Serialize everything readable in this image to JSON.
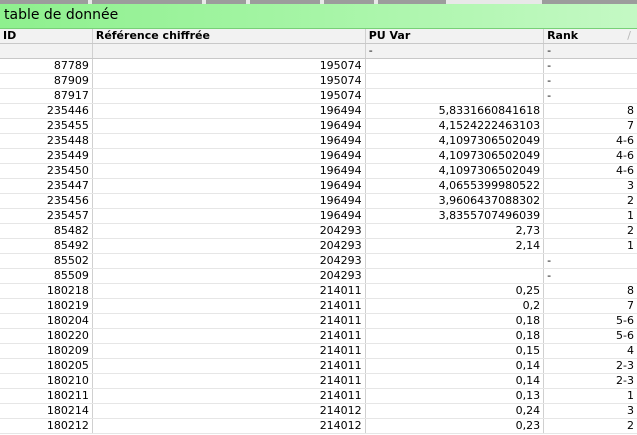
{
  "window": {
    "title": "table de donnée"
  },
  "columns": {
    "id": "ID",
    "reference": "Référence chiffrée",
    "pu_var": "PU Var",
    "rank": "Rank"
  },
  "totals": {
    "pu_var": "-",
    "rank": "-"
  },
  "rows": [
    {
      "id": "87789",
      "ref": "195074",
      "pu": "",
      "rank": "-"
    },
    {
      "id": "87909",
      "ref": "195074",
      "pu": "",
      "rank": "-"
    },
    {
      "id": "87917",
      "ref": "195074",
      "pu": "",
      "rank": "-"
    },
    {
      "id": "235446",
      "ref": "196494",
      "pu": "5,8331660841618",
      "rank": "8"
    },
    {
      "id": "235455",
      "ref": "196494",
      "pu": "4,1524222463103",
      "rank": "7"
    },
    {
      "id": "235448",
      "ref": "196494",
      "pu": "4,1097306502049",
      "rank": "4-6"
    },
    {
      "id": "235449",
      "ref": "196494",
      "pu": "4,1097306502049",
      "rank": "4-6"
    },
    {
      "id": "235450",
      "ref": "196494",
      "pu": "4,1097306502049",
      "rank": "4-6"
    },
    {
      "id": "235447",
      "ref": "196494",
      "pu": "4,0655399980522",
      "rank": "3"
    },
    {
      "id": "235456",
      "ref": "196494",
      "pu": "3,9606437088302",
      "rank": "2"
    },
    {
      "id": "235457",
      "ref": "196494",
      "pu": "3,8355707496039",
      "rank": "1"
    },
    {
      "id": "85482",
      "ref": "204293",
      "pu": "2,73",
      "rank": "2"
    },
    {
      "id": "85492",
      "ref": "204293",
      "pu": "2,14",
      "rank": "1"
    },
    {
      "id": "85502",
      "ref": "204293",
      "pu": "",
      "rank": "-"
    },
    {
      "id": "85509",
      "ref": "204293",
      "pu": "",
      "rank": "-"
    },
    {
      "id": "180218",
      "ref": "214011",
      "pu": "0,25",
      "rank": "8"
    },
    {
      "id": "180219",
      "ref": "214011",
      "pu": "0,2",
      "rank": "7"
    },
    {
      "id": "180204",
      "ref": "214011",
      "pu": "0,18",
      "rank": "5-6"
    },
    {
      "id": "180220",
      "ref": "214011",
      "pu": "0,18",
      "rank": "5-6"
    },
    {
      "id": "180209",
      "ref": "214011",
      "pu": "0,15",
      "rank": "4"
    },
    {
      "id": "180205",
      "ref": "214011",
      "pu": "0,14",
      "rank": "2-3"
    },
    {
      "id": "180210",
      "ref": "214011",
      "pu": "0,14",
      "rank": "2-3"
    },
    {
      "id": "180211",
      "ref": "214011",
      "pu": "0,13",
      "rank": "1"
    },
    {
      "id": "180214",
      "ref": "214012",
      "pu": "0,24",
      "rank": "3"
    },
    {
      "id": "180212",
      "ref": "214012",
      "pu": "0,23",
      "rank": "2"
    }
  ]
}
